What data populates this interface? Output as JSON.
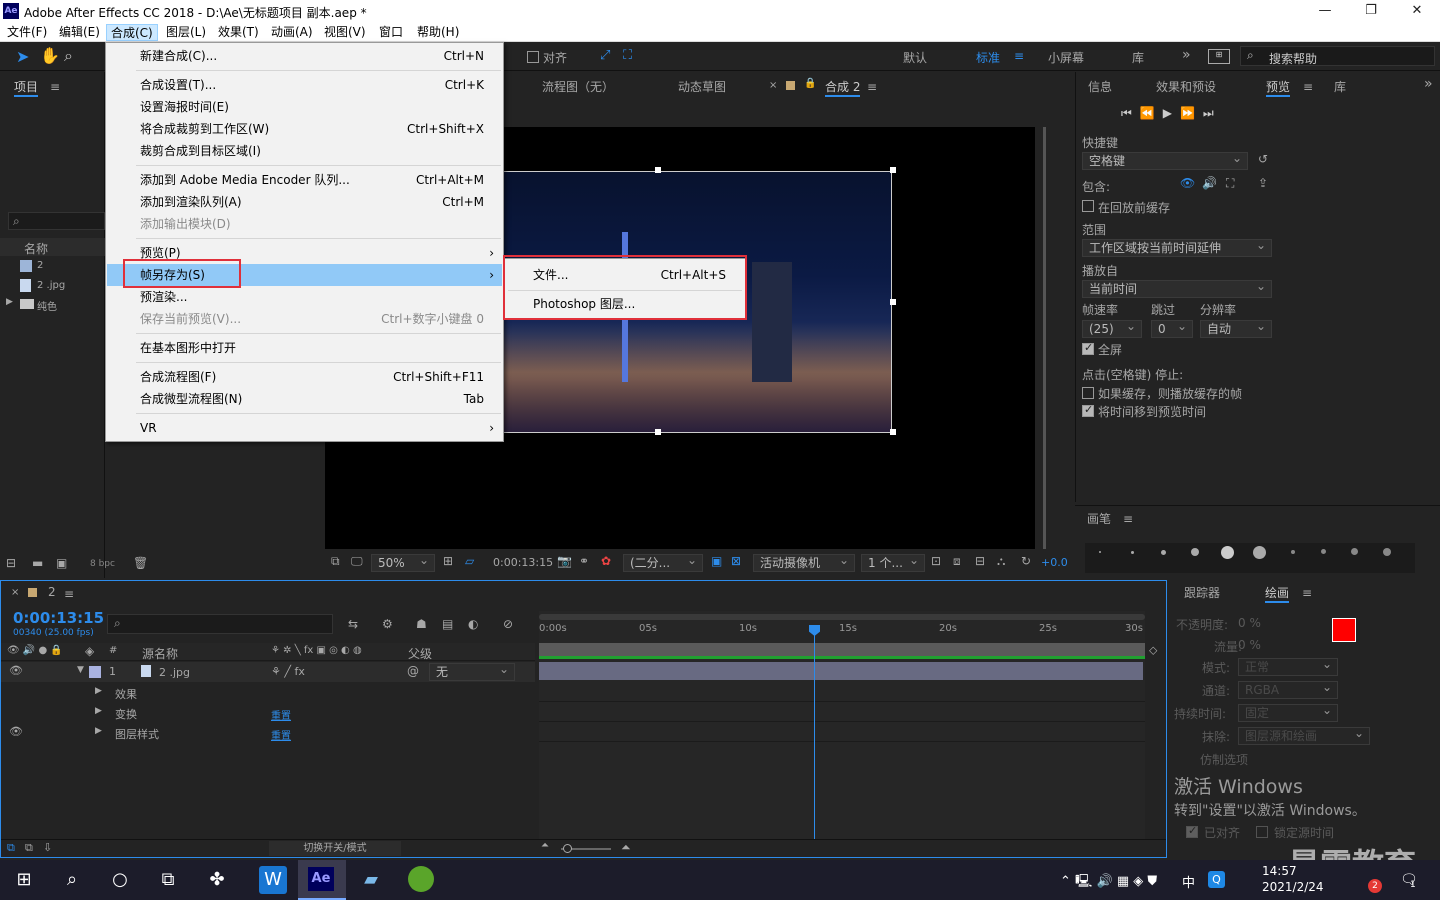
{
  "window": {
    "app_icon": "Ae",
    "title": "Adobe After Effects CC 2018 - D:\\Ae\\无标题项目 副本.aep *",
    "minimize_icon": "—",
    "maximize_icon": "❐",
    "close_icon": "✕"
  },
  "menubar": [
    {
      "label": "文件(F)"
    },
    {
      "label": "编辑(E)"
    },
    {
      "label": "合成(C)"
    },
    {
      "label": "图层(L)"
    },
    {
      "label": "效果(T)"
    },
    {
      "label": "动画(A)"
    },
    {
      "label": "视图(V)"
    },
    {
      "label": "窗口"
    },
    {
      "label": "帮助(H)"
    }
  ],
  "toolbar": {
    "snap_label": "对齐",
    "workspaces": [
      "默认",
      "标准",
      "小屏幕",
      "库"
    ],
    "active_workspace": "标准",
    "search_placeholder": "搜索帮助",
    "more": "»"
  },
  "composition_menu": {
    "items": [
      {
        "label": "新建合成(C)...",
        "shortcut": "Ctrl+N"
      },
      {
        "label": "合成设置(T)...",
        "shortcut": "Ctrl+K"
      },
      {
        "label": "设置海报时间(E)",
        "shortcut": ""
      },
      {
        "label": "将合成裁剪到工作区(W)",
        "shortcut": "Ctrl+Shift+X"
      },
      {
        "label": "裁剪合成到目标区域(I)",
        "shortcut": ""
      },
      {
        "label": "添加到 Adobe Media Encoder 队列...",
        "shortcut": "Ctrl+Alt+M"
      },
      {
        "label": "添加到渲染队列(A)",
        "shortcut": "Ctrl+M"
      },
      {
        "label": "添加输出模块(D)",
        "shortcut": ""
      },
      {
        "label": "预览(P)",
        "shortcut": ""
      },
      {
        "label": "帧另存为(S)",
        "shortcut": ""
      },
      {
        "label": "预渲染...",
        "shortcut": ""
      },
      {
        "label": "保存当前预览(V)...",
        "shortcut": "Ctrl+数字小键盘 0"
      },
      {
        "label": "在基本图形中打开",
        "shortcut": ""
      },
      {
        "label": "合成流程图(F)",
        "shortcut": "Ctrl+Shift+F11"
      },
      {
        "label": "合成微型流程图(N)",
        "shortcut": "Tab"
      },
      {
        "label": "VR",
        "shortcut": ""
      }
    ],
    "submenu_arrow": "›"
  },
  "frame_save_submenu": {
    "items": [
      {
        "label": "文件...",
        "shortcut": "Ctrl+Alt+S"
      },
      {
        "label": "Photoshop 图层...",
        "shortcut": ""
      }
    ]
  },
  "project_panel": {
    "tab": "项目",
    "search_icon": "⌕",
    "column_name": "名称",
    "items": [
      {
        "name": "2",
        "type": "comp"
      },
      {
        "name": "2 .jpg",
        "type": "image"
      },
      {
        "name": "纯色",
        "type": "folder"
      }
    ],
    "bpc": "8 bpc"
  },
  "viewer": {
    "tabs": [
      "流程图（无）",
      "动态草图",
      "合成 2"
    ],
    "zoom": "50%",
    "timecode": "0:00:13:15",
    "resolution": "(二分...",
    "camera": "活动摄像机",
    "views": "1 个...",
    "exposure": "+0.0"
  },
  "info_panel": {
    "tabs": [
      "信息",
      "效果和预设",
      "预览",
      "库"
    ],
    "active_tab": "预览",
    "shortcut_label": "快捷键",
    "shortcut_value": "空格键",
    "include_label": "包含:",
    "cache_label": "在回放前缓存",
    "range_label": "范围",
    "range_value": "工作区域按当前时间延伸",
    "play_from_label": "播放自",
    "play_from_value": "当前时间",
    "framerate_label": "帧速率",
    "skip_label": "跳过",
    "resolution_label": "分辨率",
    "framerate_value": "(25)",
    "skip_value": "0",
    "resolution_value": "自动",
    "fullscreen_label": "全屏",
    "stop_label": "点击(空格键) 停止:",
    "if_cached_label": "如果缓存，则播放缓存的帧",
    "move_time_label": "将时间移到预览时间",
    "fullscreen_checked": true,
    "if_cached_checked": false,
    "move_time_checked": true
  },
  "brush_panel": {
    "tab": "画笔",
    "sizes": [
      "1",
      "3",
      "5",
      "9",
      "13",
      "19",
      "5",
      "9",
      "13",
      "17"
    ]
  },
  "paint_panel": {
    "tabs": [
      "跟踪器",
      "绘画"
    ],
    "opacity_label": "不透明度:",
    "opacity_value": "0 %",
    "flow_label": "流量:",
    "flow_value": "0 %",
    "mode_label": "模式:",
    "mode_value": "正常",
    "channel_label": "通道:",
    "channel_value": "RGBA",
    "duration_label": "持续时间:",
    "duration_value": "固定",
    "erase_label": "抹除:",
    "erase_value": "图层源和绘画",
    "clone_label": "仿制选项",
    "aligned_label": "已对齐",
    "lock_label": "锁定源时间",
    "fg_color": "#ff0000",
    "bg_color": "#ffffff"
  },
  "timeline": {
    "comp_tab": "2",
    "timecode": "0:00:13:15",
    "frame_info": "00340 (25.00 fps)",
    "col_source": "源名称",
    "col_parent": "父级",
    "layer_number": "1",
    "layer_name": "2 .jpg",
    "parent_value": "无",
    "sublayers": [
      {
        "name": "效果",
        "value": ""
      },
      {
        "name": "变换",
        "value": "重置"
      },
      {
        "name": "图层样式",
        "value": "重置"
      }
    ],
    "ruler": [
      "0:00s",
      "05s",
      "10s",
      "15s",
      "20s",
      "25s",
      "30s"
    ],
    "playhead_fraction": 0.454,
    "switches_label": "切换开关/模式"
  },
  "watermark": {
    "line1": "激活 Windows",
    "line2": "转到\"设置\"以激活 Windows。",
    "brand": "最需教育"
  },
  "taskbar": {
    "time": "14:57",
    "date": "2021/2/24",
    "ime": "中",
    "badge_count": "2",
    "notif_count": "1"
  }
}
